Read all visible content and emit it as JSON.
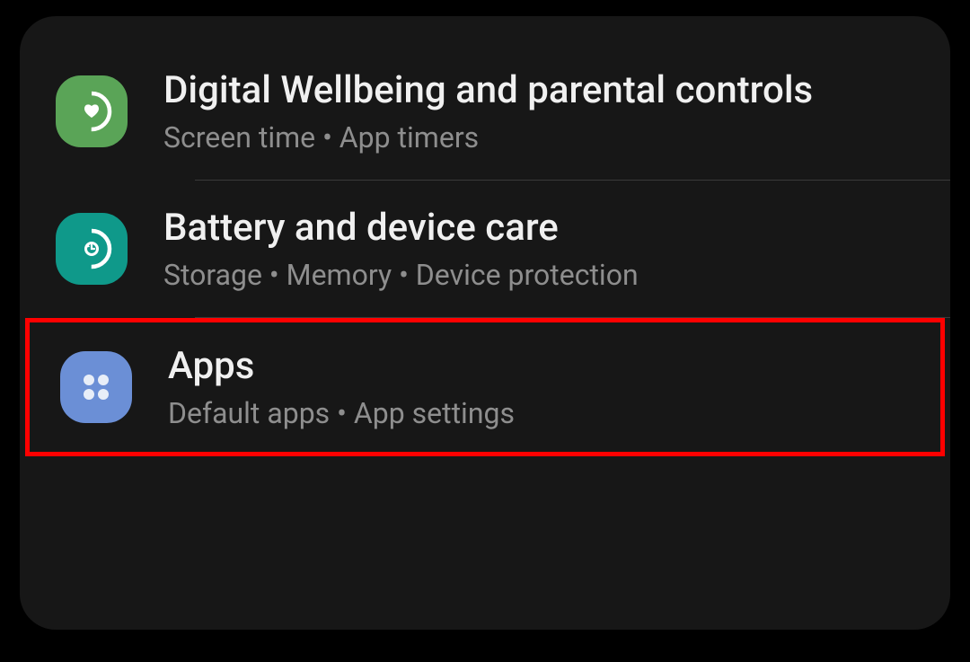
{
  "settings": {
    "items": [
      {
        "title": "Digital Wellbeing and parental controls",
        "subtitle": "Screen time  •  App timers"
      },
      {
        "title": "Battery and device care",
        "subtitle": "Storage  •  Memory  •  Device protection"
      },
      {
        "title": "Apps",
        "subtitle": "Default apps  •  App settings"
      }
    ]
  }
}
